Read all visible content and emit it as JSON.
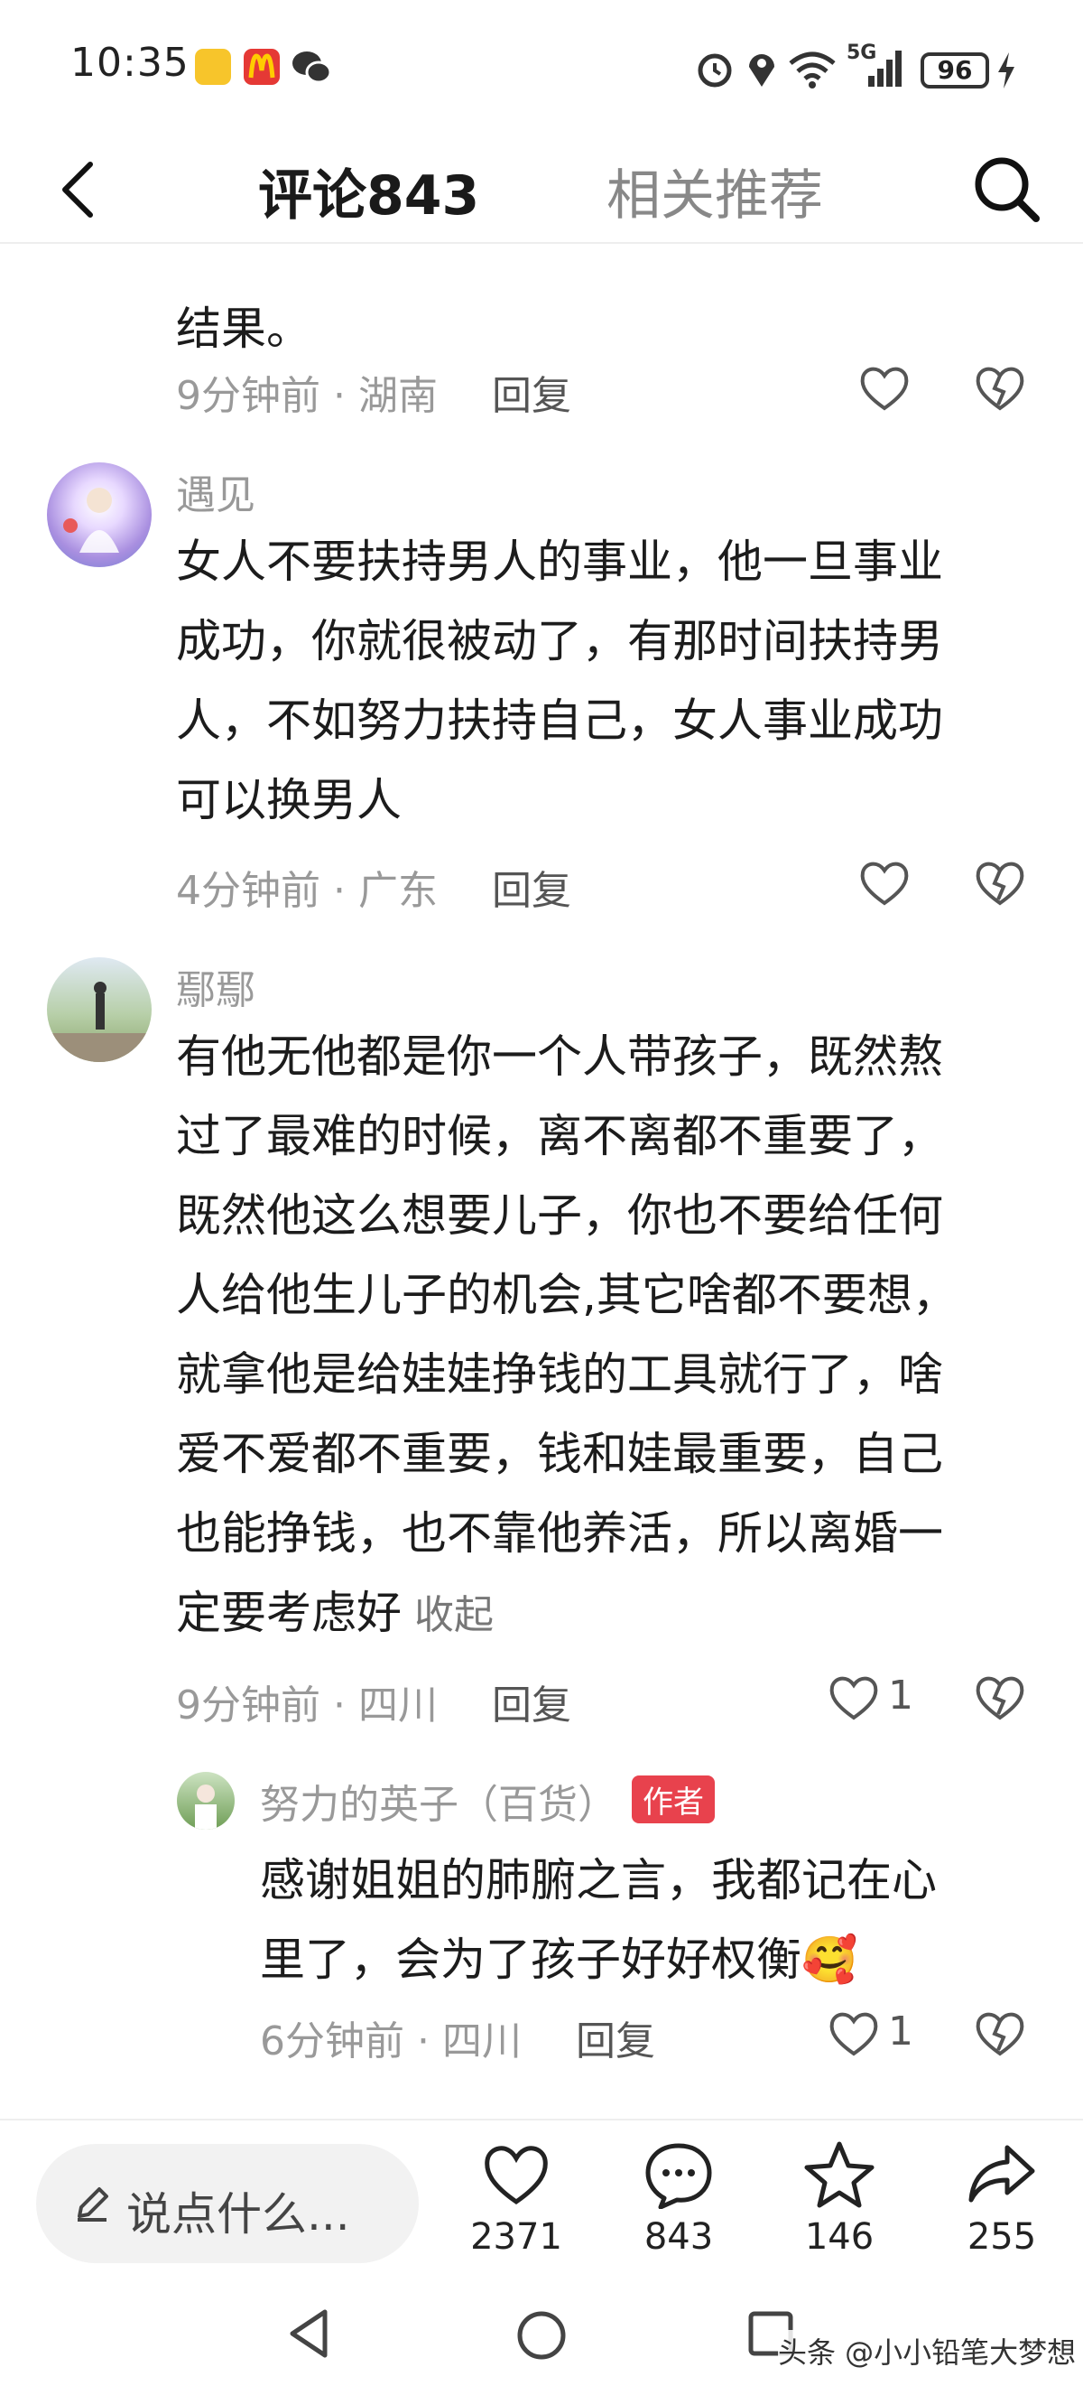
{
  "status_bar": {
    "time": "10:35",
    "network": "5G",
    "battery": "96",
    "icons": [
      "app-icon",
      "mcdonalds-icon",
      "wechat-icon",
      "alarm-icon",
      "location-icon",
      "wifi-icon",
      "signal-icon",
      "charging-icon"
    ]
  },
  "header": {
    "tab_comments": "评论843",
    "tab_related": "相关推荐",
    "icons": [
      "back-icon",
      "search-icon"
    ]
  },
  "comments": [
    {
      "text_partial": "结果。",
      "time": "9分钟前",
      "location": "湖南",
      "reply_label": "回复"
    },
    {
      "username": "遇见",
      "lines": [
        "女人不要扶持男人的事业，他一旦事业",
        "成功，你就很被动了，有那时间扶持男",
        "人，不如努力扶持自己，女人事业成功",
        "可以换男人"
      ],
      "time": "4分钟前",
      "location": "广东",
      "reply_label": "回复"
    },
    {
      "username": "鄢鄢",
      "lines": [
        "有他无他都是你一个人带孩子，既然熬",
        "过了最难的时候，离不离都不重要了，",
        "既然他这么想要儿子，你也不要给任何",
        "人给他生儿子的机会,其它啥都不要想，",
        "就拿他是给娃娃挣钱的工具就行了，啥",
        "爱不爱都不重要，钱和娃最重要，自己",
        "也能挣钱，也不靠他养活，所以离婚一",
        "定要考虑好"
      ],
      "collapse_label": "收起",
      "time": "9分钟前",
      "location": "四川",
      "reply_label": "回复",
      "likes": "1"
    }
  ],
  "reply": {
    "username": "努力的英子（百货）",
    "badge": "作者",
    "lines": [
      "感谢姐姐的肺腑之言，我都记在心",
      "里了，会为了孩子好好权衡🥰"
    ],
    "time": "6分钟前",
    "location": "四川",
    "reply_label": "回复",
    "likes": "1"
  },
  "bottom_bar": {
    "input_placeholder": "说点什么...",
    "like_count": "2371",
    "comment_count": "843",
    "favorite_count": "146",
    "share_count": "255"
  },
  "watermark": "头条 @小小铅笔大梦想",
  "colors": {
    "author_badge": "#e8424d",
    "meta_gray": "#999999",
    "text": "#1c1c1c"
  }
}
